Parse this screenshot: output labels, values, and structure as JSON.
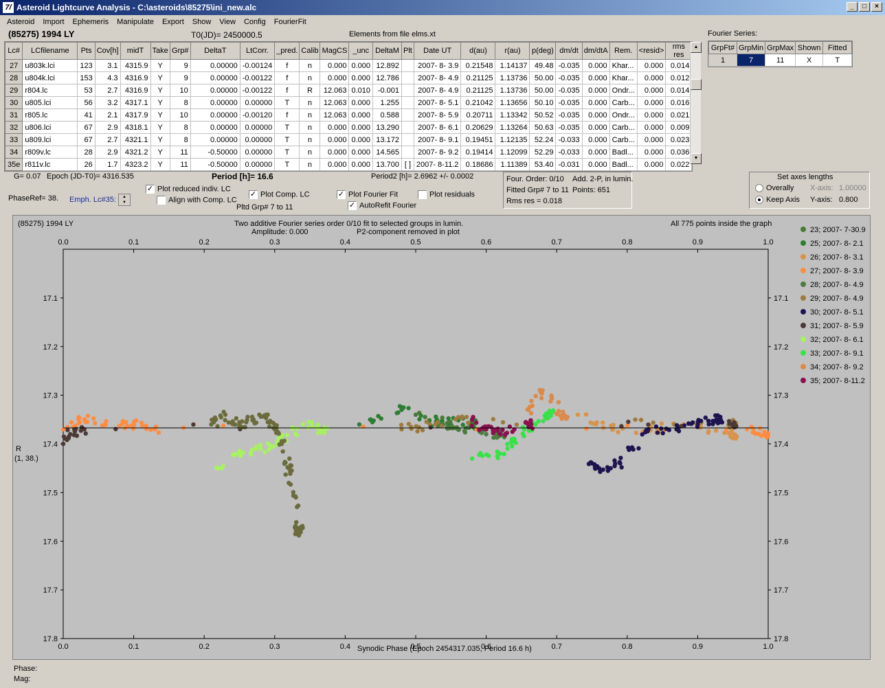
{
  "window": {
    "title": "Asteroid Lightcurve Analysis - C:\\asteroids\\85275\\ini_new.alc",
    "icon": "7/",
    "min": "_",
    "max": "□",
    "close": "×"
  },
  "menu": [
    "Asteroid",
    "Import",
    "Ephemeris",
    "Manipulate",
    "Export",
    "Show",
    "View",
    "Config",
    "FourierFit"
  ],
  "header": {
    "object": "(85275) 1994 LY",
    "t0": "T0(JD)= 2450000.5",
    "elements": "Elements from file elms.xt"
  },
  "table": {
    "columns": [
      "Lc#",
      "LCfilename",
      "Pts",
      "Cov[h]",
      "midT",
      "Take",
      "Grp#",
      "DeltaT",
      "LtCorr.",
      "_pred.",
      "Calib",
      "MagCS",
      "_unc",
      "DeltaM",
      "Plt",
      "Date UT",
      "d(au)",
      "r(au)",
      "p(deg)",
      "dm/dt",
      "dm/dtA",
      "Rem.",
      "<resid>",
      "rms res"
    ],
    "rows": [
      [
        "27",
        "u803k.lci",
        "123",
        "3.1",
        "4315.9",
        "Y",
        "9",
        "0.00000",
        "-0.00124",
        "f",
        "n",
        "0.000",
        "0.000",
        "12.892",
        "",
        "2007- 8- 3.9",
        "0.21548",
        "1.14137",
        "49.48",
        "-0.035",
        "0.000",
        "Khar...",
        "0.000",
        "0.014"
      ],
      [
        "28",
        "u804k.lci",
        "153",
        "4.3",
        "4316.9",
        "Y",
        "9",
        "0.00000",
        "-0.00122",
        "f",
        "n",
        "0.000",
        "0.000",
        "12.786",
        "",
        "2007- 8- 4.9",
        "0.21125",
        "1.13736",
        "50.00",
        "-0.035",
        "0.000",
        "Khar...",
        "0.000",
        "0.012"
      ],
      [
        "29",
        "r804.lc",
        "53",
        "2.7",
        "4316.9",
        "Y",
        "10",
        "0.00000",
        "-0.00122",
        "f",
        "R",
        "12.063",
        "0.010",
        "-0.001",
        "",
        "2007- 8- 4.9",
        "0.21125",
        "1.13736",
        "50.00",
        "-0.035",
        "0.000",
        "Ondr...",
        "0.000",
        "0.014"
      ],
      [
        "30",
        "u805.lci",
        "56",
        "3.2",
        "4317.1",
        "Y",
        "8",
        "0.00000",
        "0.00000",
        "T",
        "n",
        "12.063",
        "0.000",
        "1.255",
        "",
        "2007- 8- 5.1",
        "0.21042",
        "1.13656",
        "50.10",
        "-0.035",
        "0.000",
        "Carb...",
        "0.000",
        "0.016"
      ],
      [
        "31",
        "r805.lc",
        "41",
        "2.1",
        "4317.9",
        "Y",
        "10",
        "0.00000",
        "-0.00120",
        "f",
        "n",
        "12.063",
        "0.000",
        "0.588",
        "",
        "2007- 8- 5.9",
        "0.20711",
        "1.13342",
        "50.52",
        "-0.035",
        "0.000",
        "Ondr...",
        "0.000",
        "0.021"
      ],
      [
        "32",
        "u806.lci",
        "67",
        "2.9",
        "4318.1",
        "Y",
        "8",
        "0.00000",
        "0.00000",
        "T",
        "n",
        "0.000",
        "0.000",
        "13.290",
        "",
        "2007- 8- 6.1",
        "0.20629",
        "1.13264",
        "50.63",
        "-0.035",
        "0.000",
        "Carb...",
        "0.000",
        "0.009"
      ],
      [
        "33",
        "u809.lci",
        "67",
        "2.7",
        "4321.1",
        "Y",
        "8",
        "0.00000",
        "0.00000",
        "T",
        "n",
        "0.000",
        "0.000",
        "13.172",
        "",
        "2007- 8- 9.1",
        "0.19451",
        "1.12135",
        "52.24",
        "-0.033",
        "0.000",
        "Carb...",
        "0.000",
        "0.023"
      ],
      [
        "34",
        "r809v.lc",
        "28",
        "2.9",
        "4321.2",
        "Y",
        "11",
        "-0.50000",
        "0.00000",
        "T",
        "n",
        "0.000",
        "0.000",
        "14.565",
        "",
        "2007- 8- 9.2",
        "0.19414",
        "1.12099",
        "52.29",
        "-0.033",
        "0.000",
        "Badl...",
        "0.000",
        "0.036"
      ],
      [
        "35e",
        "r811v.lc",
        "26",
        "1.7",
        "4323.2",
        "Y",
        "11",
        "-0.50000",
        "0.00000",
        "T",
        "n",
        "0.000",
        "0.000",
        "13.700",
        "[ ]",
        "2007- 8-11.2",
        "0.18686",
        "1.11389",
        "53.40",
        "-0.031",
        "0.000",
        "Badl...",
        "0.000",
        "0.022"
      ]
    ]
  },
  "fourier": {
    "label": "Fourier Series:",
    "columns": [
      "GrpFt#",
      "GrpMin",
      "GrpMax",
      "Shown",
      "Fitted"
    ],
    "row": [
      "1",
      "7",
      "11",
      "X",
      "T"
    ]
  },
  "controls": {
    "g": "G= 0.07",
    "epoch": "Epoch (JD-T0)= 4316.535",
    "period": "Period [h]= 16.6",
    "period2": "Period2 [h]= 2.6962 +/- 0.0002",
    "phaseref": "PhaseRef= 38.",
    "emph": "Emph. Lc#35:",
    "plot_reduced": "Plot reduced indiv. LC",
    "align": "Align with Comp. LC",
    "plot_comp": "Plot Comp. LC",
    "pltd_grp": "Pltd Grp#  7   to   11",
    "plot_fourier": "Plot Fourier Fit",
    "autorefit": "AutoRefit Fourier",
    "plot_resid": "Plot residuals",
    "check_mark": "✓"
  },
  "info": {
    "order": "Four. Order:  0/10",
    "add": "Add. 2-P, in lumin.",
    "fitted": "Fitted Grp# 7 to 11",
    "points": "Points: 651",
    "rms": "Rms res      = 0.018"
  },
  "axes_box": {
    "title": "Set axes lengths",
    "overally": "Overally",
    "keep": "Keep Axis",
    "xaxis_label": "X-axis:",
    "xaxis_val": "1.00000",
    "yaxis_label": "Y-axis:",
    "yaxis_val": "0.800"
  },
  "plot": {
    "object": "(85275) 1994 LY",
    "title1": "Two additive Fourier series order 0/10 fit to selected groups in lumin.",
    "title2a": "Amplitude: 0.000",
    "title2b": "P2-component removed in plot",
    "inside": "All 775 points inside the graph",
    "ylabel1": "R",
    "ylabel2": "(1, 38.)",
    "xlabel": "Synodic Phase (Epoch 2454317.035, Period 16.6 h)"
  },
  "footer": {
    "phase": "Phase:",
    "mag": "Mag:"
  },
  "chart_data": {
    "type": "scatter",
    "title": "Two additive Fourier series order 0/10 fit to selected groups in lumin.",
    "xlabel": "Synodic Phase (Epoch 2454317.035, Period 16.6 h)",
    "ylabel": "R",
    "xlim": [
      0,
      1
    ],
    "ylim": [
      17.0,
      17.8
    ],
    "y_inverted": true,
    "x_ticks": [
      "0.0",
      "0.1",
      "0.2",
      "0.3",
      "0.4",
      "0.5",
      "0.6",
      "0.7",
      "0.8",
      "0.9",
      "1.0"
    ],
    "y_ticks": [
      "17.1",
      "17.2",
      "17.3",
      "17.4",
      "17.5",
      "17.6",
      "17.7",
      "17.8"
    ],
    "fit_line": 17.367,
    "series": [
      {
        "name": "23; 2007- 7-30.9",
        "color": "#4a7a3a",
        "points": [
          [
            0.5,
            17.34
          ],
          [
            0.55,
            17.36
          ]
        ]
      },
      {
        "name": "25; 2007- 8- 2.1",
        "color": "#2e7d32",
        "points": [
          [
            0.42,
            17.36
          ],
          [
            0.48,
            17.33
          ],
          [
            0.53,
            17.35
          ],
          [
            0.58,
            17.36
          ]
        ]
      },
      {
        "name": "26; 2007- 8- 3.1",
        "color": "#d6944e",
        "points": [
          [
            0.73,
            17.34
          ],
          [
            0.78,
            17.37
          ],
          [
            0.83,
            17.37
          ],
          [
            0.88,
            17.36
          ],
          [
            0.95,
            17.38
          ]
        ]
      },
      {
        "name": "27; 2007- 8- 3.9",
        "color": "#ff8c42",
        "points": [
          [
            0.0,
            17.37
          ],
          [
            0.03,
            17.35
          ],
          [
            0.06,
            17.36
          ],
          [
            0.1,
            17.36
          ],
          [
            0.13,
            17.37
          ],
          [
            0.97,
            17.37
          ],
          [
            1.0,
            17.38
          ]
        ]
      },
      {
        "name": "28; 2007- 8- 4.9",
        "color": "#4e7b3f",
        "points": [
          [
            0.52,
            17.36
          ],
          [
            0.56,
            17.37
          ],
          [
            0.6,
            17.38
          ],
          [
            0.62,
            17.38
          ]
        ]
      },
      {
        "name": "29; 2007- 8- 4.9",
        "color": "#9c7b40",
        "points": [
          [
            0.48,
            17.37
          ],
          [
            0.52,
            17.36
          ],
          [
            0.58,
            17.35
          ],
          [
            0.95,
            17.36
          ]
        ]
      },
      {
        "name": "30; 2007- 8- 5.1",
        "color": "#1e1450",
        "points": [
          [
            0.75,
            17.44
          ],
          [
            0.76,
            17.45
          ],
          [
            0.79,
            17.44
          ],
          [
            0.83,
            17.37
          ],
          [
            0.87,
            17.37
          ],
          [
            0.9,
            17.36
          ],
          [
            0.93,
            17.35
          ]
        ]
      },
      {
        "name": "31; 2007- 8- 5.9",
        "color": "#4b3a36",
        "points": [
          [
            0.0,
            17.4
          ],
          [
            0.01,
            17.38
          ],
          [
            0.03,
            17.37
          ],
          [
            0.95,
            17.36
          ]
        ]
      },
      {
        "name": "32; 2007- 8- 6.1",
        "color": "#a8f064",
        "points": [
          [
            0.22,
            17.45
          ],
          [
            0.25,
            17.42
          ],
          [
            0.28,
            17.41
          ],
          [
            0.31,
            17.39
          ],
          [
            0.34,
            17.36
          ],
          [
            0.37,
            17.37
          ]
        ]
      },
      {
        "name": "33; 2007- 8- 9.1",
        "color": "#3ae04a",
        "points": [
          [
            0.58,
            17.43
          ],
          [
            0.62,
            17.42
          ],
          [
            0.64,
            17.39
          ],
          [
            0.67,
            17.36
          ],
          [
            0.69,
            17.34
          ]
        ]
      },
      {
        "name": "34; 2007- 8- 9.2",
        "color": "#d98a4c",
        "points": [
          [
            0.66,
            17.33
          ],
          [
            0.68,
            17.29
          ],
          [
            0.71,
            17.34
          ]
        ]
      },
      {
        "name": "35; 2007- 8-11.2",
        "color": "#8a1050",
        "points": [
          [
            0.58,
            17.35
          ],
          [
            0.6,
            17.37
          ],
          [
            0.62,
            17.38
          ],
          [
            0.66,
            17.36
          ]
        ]
      },
      {
        "name": "",
        "color": "#6b6b3e",
        "points": [
          [
            0.21,
            17.36
          ],
          [
            0.23,
            17.34
          ],
          [
            0.25,
            17.36
          ],
          [
            0.27,
            17.35
          ],
          [
            0.29,
            17.34
          ],
          [
            0.3,
            17.37
          ],
          [
            0.31,
            17.4
          ],
          [
            0.32,
            17.45
          ],
          [
            0.33,
            17.51
          ],
          [
            0.335,
            17.58
          ]
        ]
      }
    ]
  }
}
